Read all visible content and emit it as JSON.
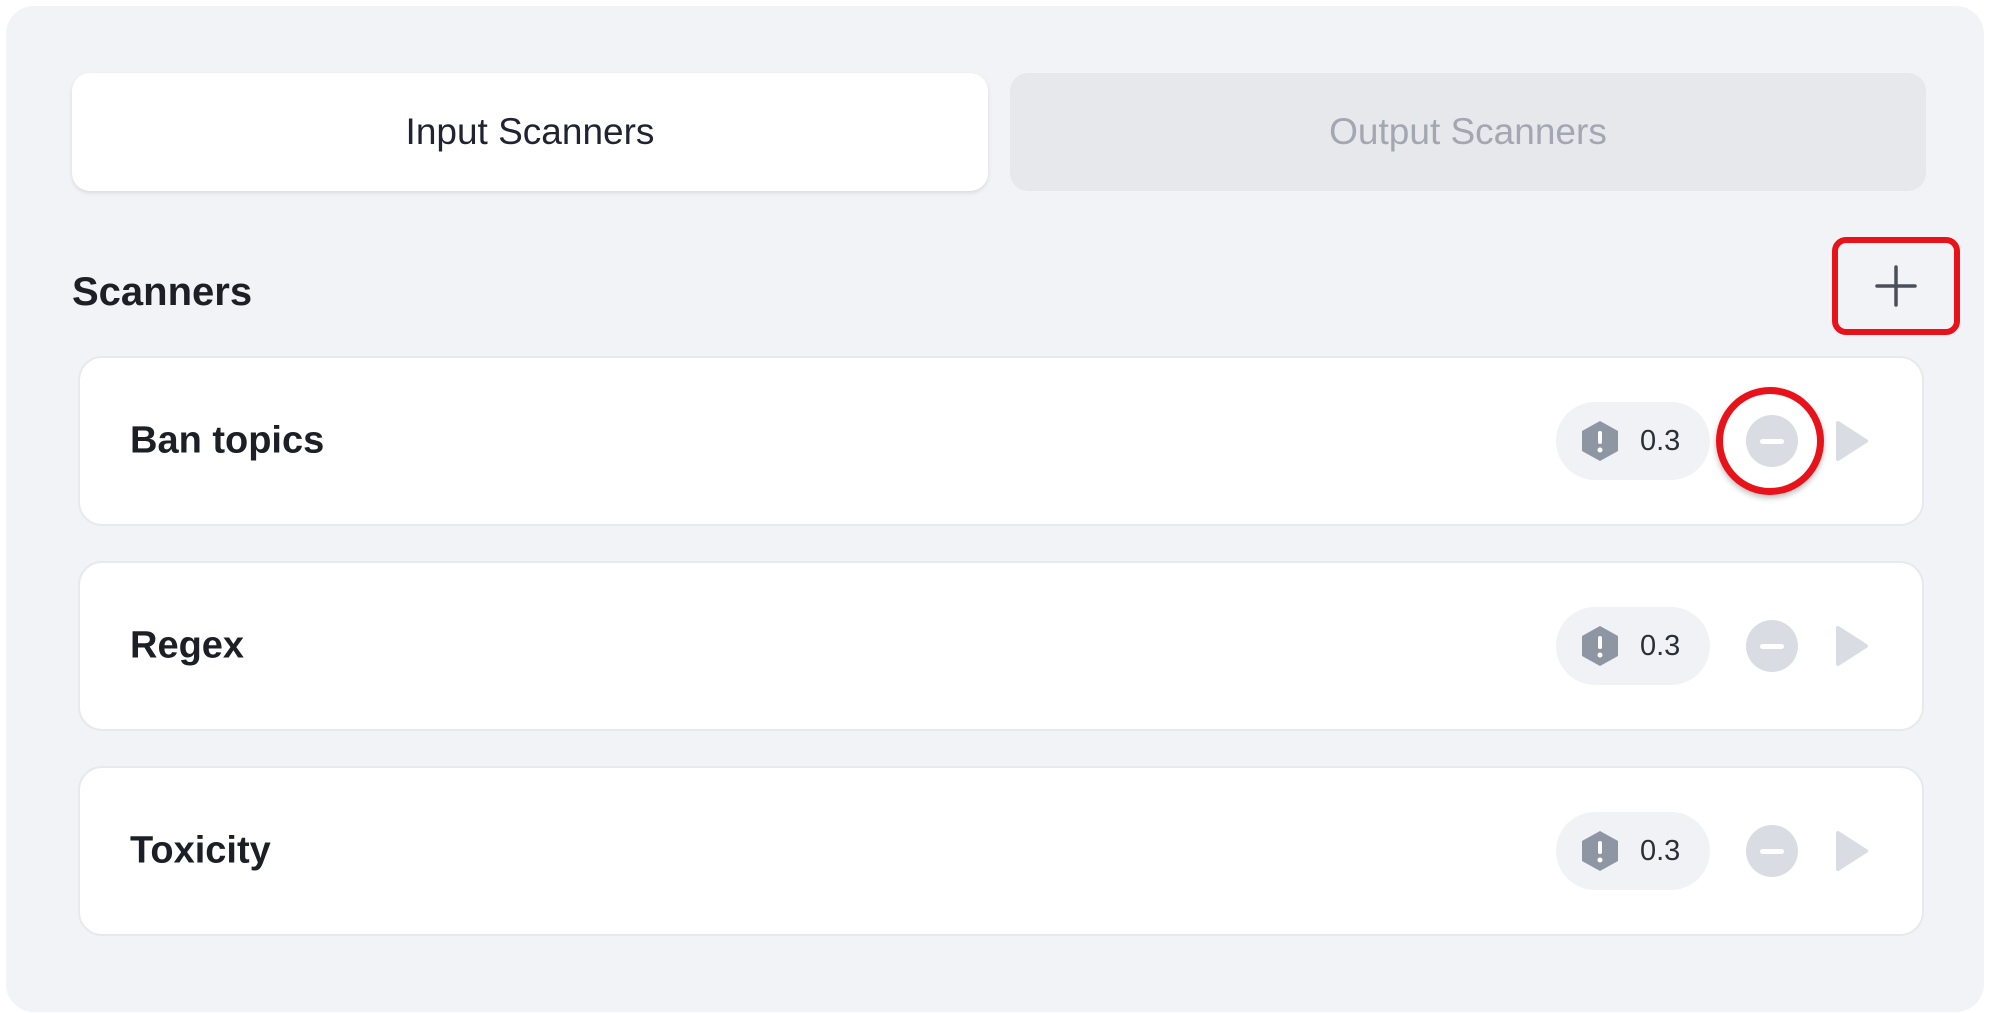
{
  "tabs": [
    {
      "label": "Input Scanners",
      "active": true
    },
    {
      "label": "Output Scanners",
      "active": false
    }
  ],
  "section": {
    "title": "Scanners",
    "add_icon": "plus-icon"
  },
  "scanners": [
    {
      "name": "Ban topics",
      "threshold": "0.3",
      "remove_highlighted": true
    },
    {
      "name": "Regex",
      "threshold": "0.3",
      "remove_highlighted": false
    },
    {
      "name": "Toxicity",
      "threshold": "0.3",
      "remove_highlighted": false
    }
  ],
  "icons": {
    "threshold": "warning-hexagon-icon",
    "remove": "minus-circle-icon",
    "run": "play-icon"
  },
  "colors": {
    "highlight": "#e8121b",
    "panel_bg": "#f2f3f6",
    "icon_gray": "#9aa0ab"
  }
}
